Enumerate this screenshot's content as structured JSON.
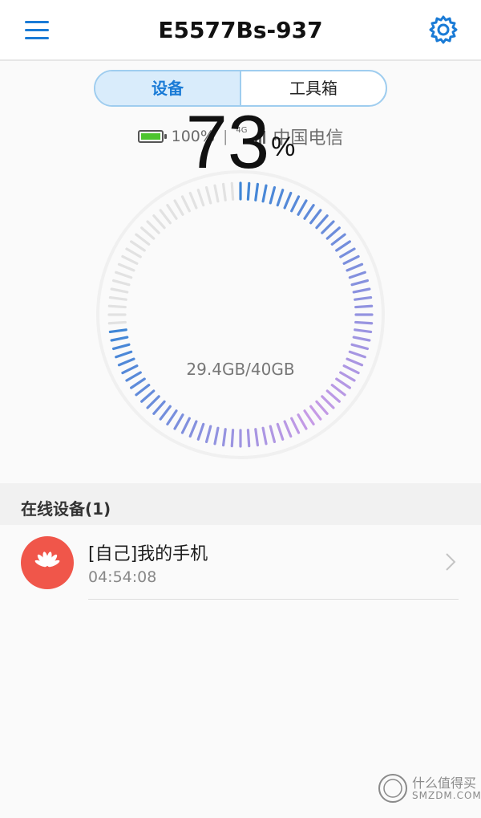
{
  "header": {
    "title": "E5577Bs-937",
    "menu_icon": "hamburger-menu-icon",
    "settings_icon": "gear-icon"
  },
  "tabs": [
    {
      "label": "设备",
      "active": true
    },
    {
      "label": "工具箱",
      "active": false
    }
  ],
  "status": {
    "battery_percent": "100%",
    "battery_level": 1.0,
    "separator": "|",
    "network_type": "4G",
    "signal_bars": 5,
    "carrier": "中国电信"
  },
  "usage": {
    "percent": "73",
    "percent_sign": "%",
    "used_total": "29.4GB/40GB",
    "fraction": 0.73
  },
  "online_devices": {
    "section_title": "在线设备(1)",
    "items": [
      {
        "name": "[自己]我的手机",
        "time": "04:54:08",
        "icon": "huawei-logo-icon"
      }
    ]
  },
  "watermark": {
    "cn": "什么值得买",
    "en": "SMZDM.COM"
  },
  "colors": {
    "accent": "#1a7bd6",
    "gauge_start": "#3f86d6",
    "gauge_end": "#c89be6",
    "gauge_track": "#e2e2e2",
    "battery": "#4dc42f",
    "avatar": "#f0564a"
  }
}
